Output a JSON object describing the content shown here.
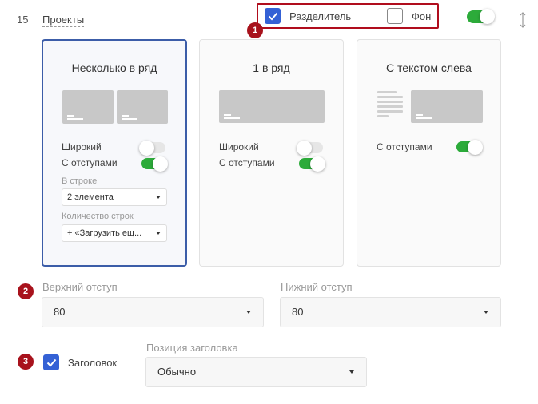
{
  "section": {
    "index": "15",
    "name": "Проекты"
  },
  "top_options": {
    "divider": {
      "label": "Разделитель",
      "checked": true
    },
    "background": {
      "label": "Фон",
      "checked": false
    },
    "block_enabled": true
  },
  "badges": [
    "1",
    "2",
    "3"
  ],
  "layouts": [
    {
      "title": "Несколько в ряд",
      "selected": true,
      "wide_label": "Широкий",
      "wide_on": false,
      "padding_label": "С отступами",
      "padding_on": true,
      "per_row_label": "В строке",
      "per_row_value": "2 элемента",
      "rows_label": "Количество строк",
      "rows_value": "+ «Загрузить ещ..."
    },
    {
      "title": "1 в ряд",
      "selected": false,
      "wide_label": "Широкий",
      "wide_on": false,
      "padding_label": "С отступами",
      "padding_on": true
    },
    {
      "title": "С текстом слева",
      "selected": false,
      "padding_label": "С отступами",
      "padding_on": true
    }
  ],
  "spacing": {
    "top_label": "Верхний отступ",
    "top_value": "80",
    "bottom_label": "Нижний отступ",
    "bottom_value": "80"
  },
  "heading": {
    "label": "Заголовок",
    "checked": true,
    "position_label": "Позиция заголовка",
    "position_value": "Обычно"
  },
  "colors": {
    "accent": "#3461d5",
    "toggle_on": "#2cab3a",
    "badge": "#a8121c"
  }
}
